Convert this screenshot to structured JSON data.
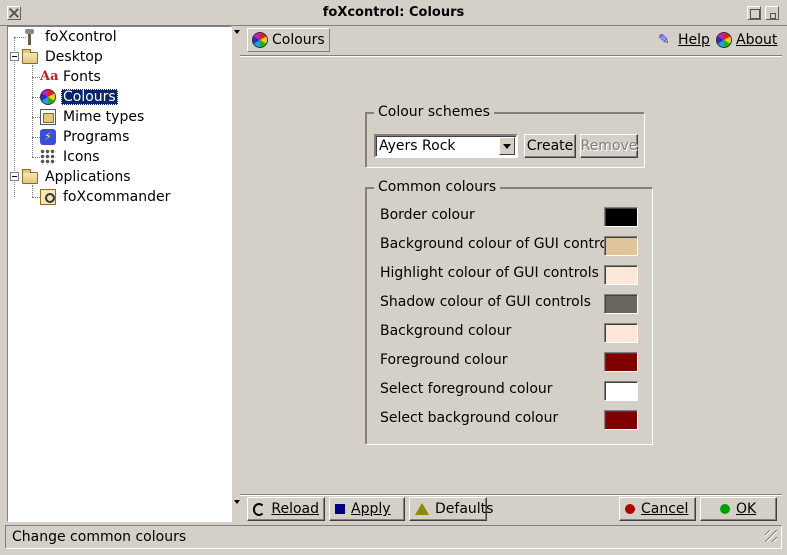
{
  "window": {
    "title": "foXcontrol: Colours"
  },
  "tree": {
    "items": [
      {
        "label": "foXcontrol",
        "icon": "wrench-icon"
      },
      {
        "label": "Desktop",
        "icon": "folder-icon"
      },
      {
        "label": "Fonts",
        "icon": "fonts-icon"
      },
      {
        "label": "Colours",
        "icon": "colour-wheel-icon",
        "selected": true
      },
      {
        "label": "Mime types",
        "icon": "mime-types-icon"
      },
      {
        "label": "Programs",
        "icon": "programs-icon"
      },
      {
        "label": "Icons",
        "icon": "icons-grid-icon"
      },
      {
        "label": "Applications",
        "icon": "folder-icon"
      },
      {
        "label": "foXcommander",
        "icon": "foxcommander-icon"
      }
    ]
  },
  "toolbar": {
    "colours_label": "Colours",
    "help_label": "Help",
    "about_label": "About"
  },
  "schemes": {
    "legend": "Colour schemes",
    "selected": "Ayers Rock",
    "create_label": "Create",
    "remove_label": "Remove"
  },
  "common": {
    "legend": "Common colours",
    "rows": [
      {
        "label": "Border colour",
        "color": "#000000"
      },
      {
        "label": "Background colour of GUI controls",
        "color": "#e0c49c"
      },
      {
        "label": "Highlight colour of GUI controls",
        "color": "#fde7d8"
      },
      {
        "label": "Shadow colour of GUI controls",
        "color": "#6a665e"
      },
      {
        "label": "Background colour",
        "color": "#fde7d8"
      },
      {
        "label": "Foreground colour",
        "color": "#800000"
      },
      {
        "label": "Select foreground colour",
        "color": "#ffffff"
      },
      {
        "label": "Select background colour",
        "color": "#800000"
      }
    ]
  },
  "bottom": {
    "reload_label": "Reload",
    "apply_label": "Apply",
    "defaults_label": "Defaults",
    "cancel_label": "Cancel",
    "ok_label": "OK"
  },
  "status": {
    "text": "Change common colours"
  }
}
